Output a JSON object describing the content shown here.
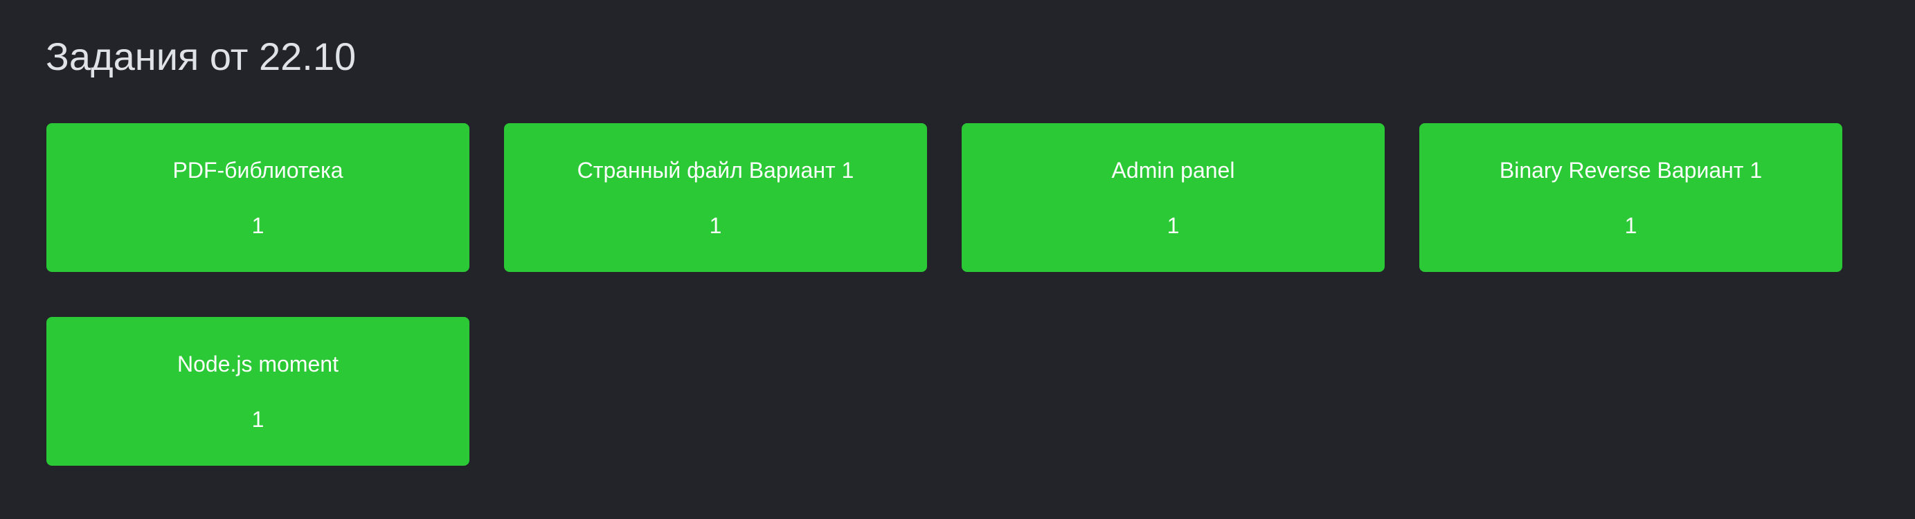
{
  "page": {
    "title": "Задания от 22.10"
  },
  "challenges": [
    {
      "title": "PDF-библиотека",
      "value": "1"
    },
    {
      "title": "Странный файл Вариант 1",
      "value": "1"
    },
    {
      "title": "Admin panel",
      "value": "1"
    },
    {
      "title": "Binary Reverse Вариант 1",
      "value": "1"
    },
    {
      "title": "Node.js moment",
      "value": "1"
    }
  ],
  "colors": {
    "background": "#222429",
    "card": "#2bc935",
    "card_text": "#ffffff",
    "title_text": "#dfe3e8"
  }
}
